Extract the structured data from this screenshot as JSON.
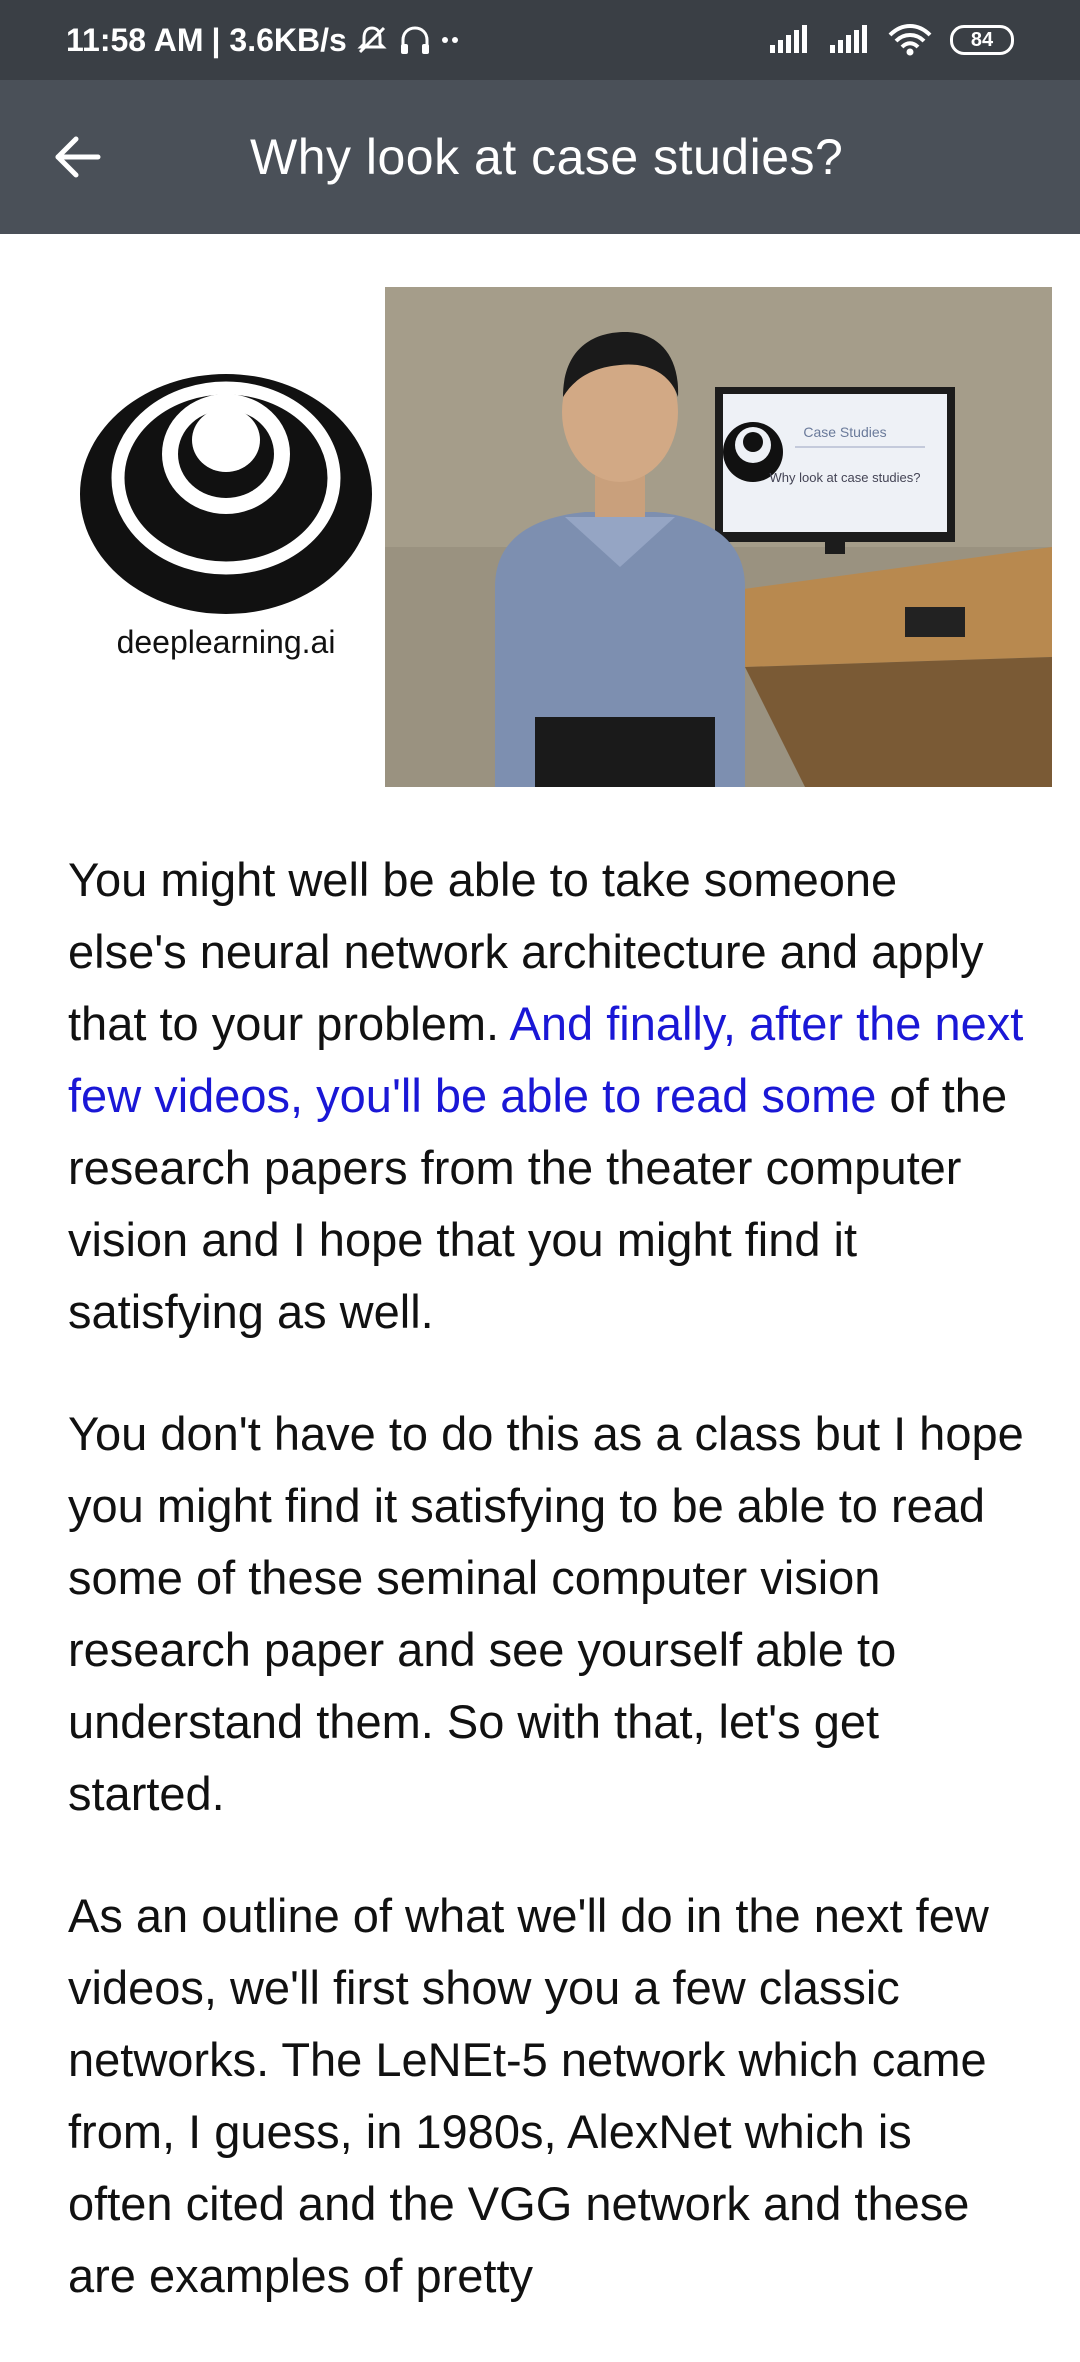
{
  "status_bar": {
    "time": "11:58 AM",
    "speed": "| 3.6KB/s",
    "battery": "84",
    "icons": [
      "mute-icon",
      "headset-icon",
      "signal-icon",
      "signal-icon",
      "wifi-icon",
      "battery-icon"
    ]
  },
  "app_bar": {
    "title": "Why look at case studies?",
    "back_icon": "arrow-left-icon"
  },
  "media": {
    "logo_caption": "deeplearning.ai",
    "screen_title": "Case Studies",
    "screen_subtitle": "Why look at case studies?"
  },
  "transcript": {
    "para1_before": "You might well be able to take someone else's neural network architecture and apply that to your problem. ",
    "para1_highlight": "And finally, after the next few videos, you'll be able to read some",
    "para1_after": " of the research papers from the theater computer vision and I hope that you might find it satisfying as well.",
    "para2": "You don't have to do this as a class but I hope you might find it satisfying to be able to read some of these seminal computer vision research paper and see yourself able to understand them. So with that, let's get started.",
    "para3": "As an outline of what we'll do in the next few videos, we'll first show you a few classic networks. The LeNEt-5 network which came from, I guess, in 1980s, AlexNet which is often cited and the VGG network and these are examples of pretty"
  },
  "colors": {
    "status_bar_bg": "#3a3f45",
    "app_bar_bg": "#4a5058",
    "highlight_text": "#1a17d6",
    "body_text": "#111111"
  }
}
